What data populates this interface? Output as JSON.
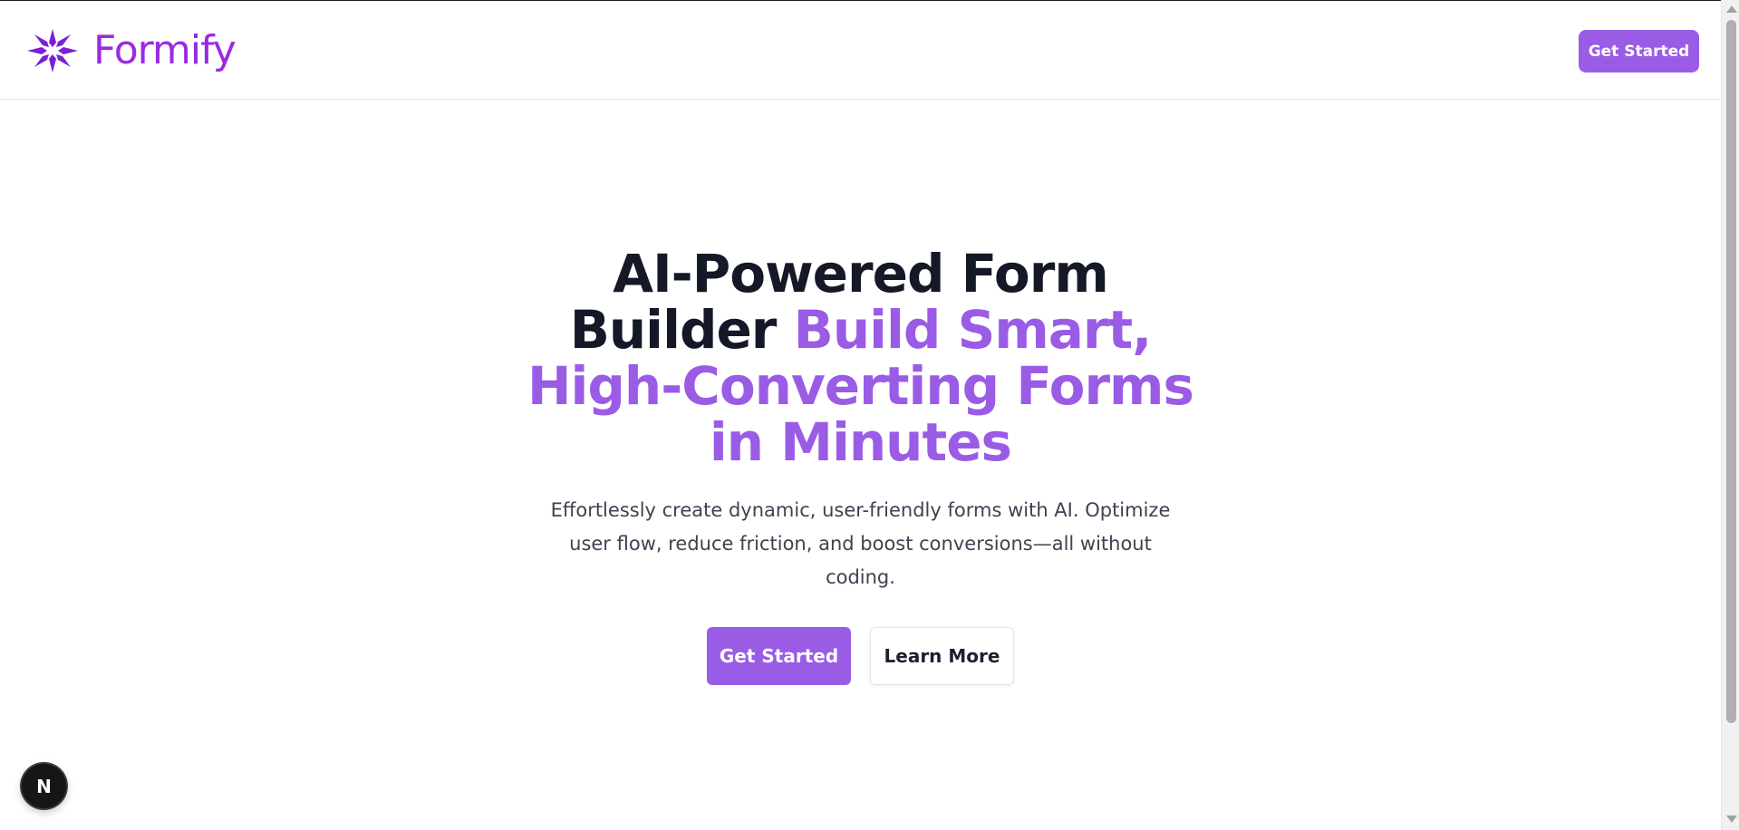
{
  "brand": {
    "name": "Formify",
    "icon": "asterisk-star-logo-icon",
    "color": "#9b2ae0"
  },
  "nav": {
    "cta_label": "Get Started"
  },
  "hero": {
    "title_dark": "AI-Powered Form Builder",
    "title_accent": "Build Smart, High-Converting Forms in Minutes",
    "subtitle": "Effortlessly create dynamic, user-friendly forms with AI. Optimize user flow, reduce friction, and boost conversions—all without coding.",
    "primary_label": "Get Started",
    "secondary_label": "Learn More"
  },
  "dev_badge": {
    "letter": "N",
    "icon": "nextjs-dev-indicator-icon"
  },
  "colors": {
    "accent": "#9a5ce5",
    "heading": "#141827",
    "body_text": "#3d4350"
  }
}
